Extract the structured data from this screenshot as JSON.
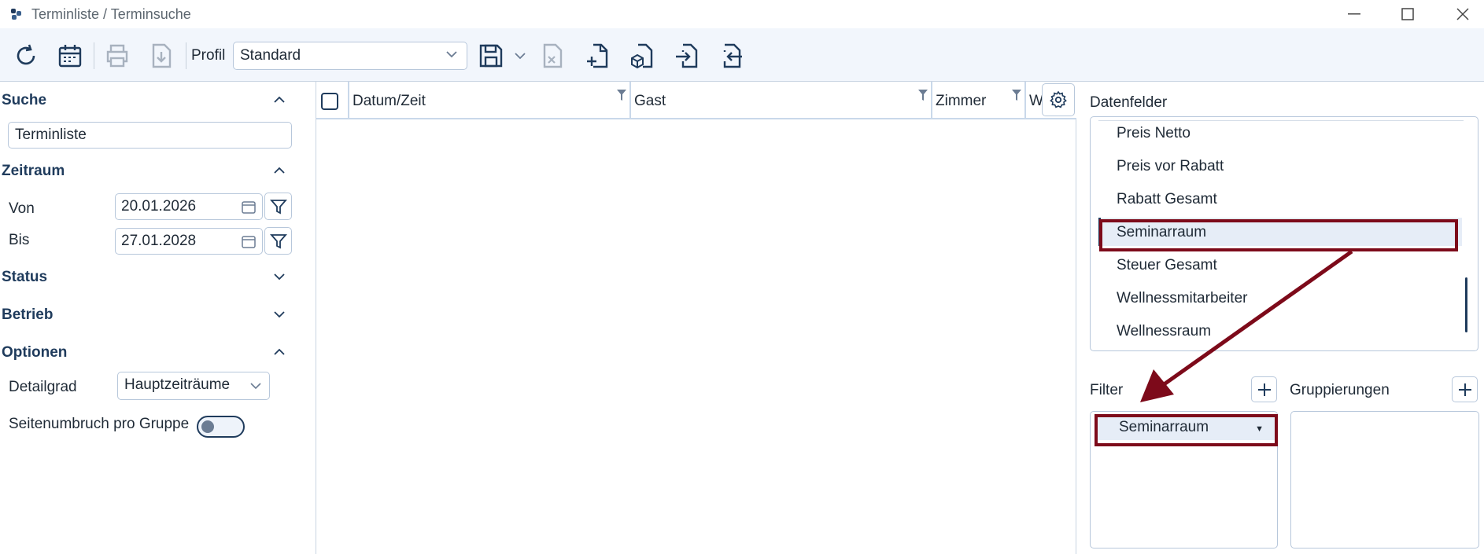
{
  "window": {
    "title": "Terminliste / Terminsuche"
  },
  "toolbar": {
    "profil_label": "Profil",
    "profil_value": "Standard",
    "buttons": [
      "refresh-icon",
      "calendar-icon",
      "print-icon",
      "download-icon",
      "save-icon",
      "save-dropdown-icon",
      "excel-export-icon",
      "new-document-icon",
      "package-icon",
      "import-icon",
      "export-icon"
    ]
  },
  "left": {
    "suche": {
      "title": "Suche",
      "value": "Terminliste"
    },
    "zeitraum": {
      "title": "Zeitraum",
      "von_label": "Von",
      "von_value": "20.01.2026",
      "bis_label": "Bis",
      "bis_value": "27.01.2028"
    },
    "status": {
      "title": "Status"
    },
    "betrieb": {
      "title": "Betrieb"
    },
    "optionen": {
      "title": "Optionen",
      "detailgrad_label": "Detailgrad",
      "detailgrad_value": "Hauptzeiträume",
      "seitenumbruch_label": "Seitenumbruch pro Gruppe",
      "seitenumbruch_on": false
    }
  },
  "grid": {
    "columns": [
      "Datum/Zeit",
      "Gast",
      "Zimmer",
      "W"
    ]
  },
  "right": {
    "datenfelder_label": "Datenfelder",
    "fields": [
      "Preis Netto",
      "Preis vor Rabatt",
      "Rabatt Gesamt",
      "Seminarraum",
      "Steuer Gesamt",
      "Wellnessmitarbeiter",
      "Wellnessraum"
    ],
    "selected_field": "Seminarraum",
    "filter_label": "Filter",
    "filter_items": [
      "Seminarraum"
    ],
    "gruppierungen_label": "Gruppierungen"
  },
  "colors": {
    "accent": "#1f3b5c",
    "annotation": "#7d0a1a",
    "toolbar_bg": "#f2f6fc"
  }
}
